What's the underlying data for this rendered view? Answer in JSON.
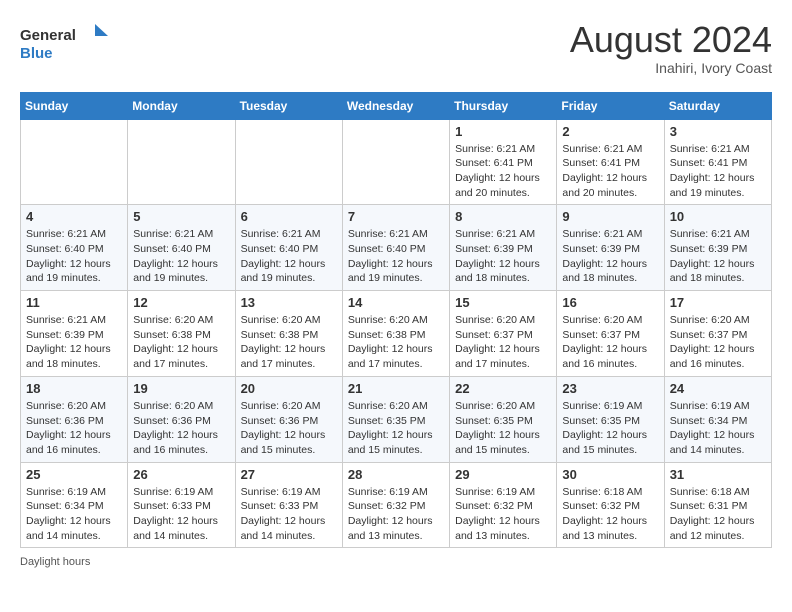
{
  "logo": {
    "text_general": "General",
    "text_blue": "Blue"
  },
  "title": "August 2024",
  "subtitle": "Inahiri, Ivory Coast",
  "days_of_week": [
    "Sunday",
    "Monday",
    "Tuesday",
    "Wednesday",
    "Thursday",
    "Friday",
    "Saturday"
  ],
  "weeks": [
    [
      {
        "day": "",
        "info": ""
      },
      {
        "day": "",
        "info": ""
      },
      {
        "day": "",
        "info": ""
      },
      {
        "day": "",
        "info": ""
      },
      {
        "day": "1",
        "info": "Sunrise: 6:21 AM\nSunset: 6:41 PM\nDaylight: 12 hours and 20 minutes."
      },
      {
        "day": "2",
        "info": "Sunrise: 6:21 AM\nSunset: 6:41 PM\nDaylight: 12 hours and 20 minutes."
      },
      {
        "day": "3",
        "info": "Sunrise: 6:21 AM\nSunset: 6:41 PM\nDaylight: 12 hours and 19 minutes."
      }
    ],
    [
      {
        "day": "4",
        "info": "Sunrise: 6:21 AM\nSunset: 6:40 PM\nDaylight: 12 hours and 19 minutes."
      },
      {
        "day": "5",
        "info": "Sunrise: 6:21 AM\nSunset: 6:40 PM\nDaylight: 12 hours and 19 minutes."
      },
      {
        "day": "6",
        "info": "Sunrise: 6:21 AM\nSunset: 6:40 PM\nDaylight: 12 hours and 19 minutes."
      },
      {
        "day": "7",
        "info": "Sunrise: 6:21 AM\nSunset: 6:40 PM\nDaylight: 12 hours and 19 minutes."
      },
      {
        "day": "8",
        "info": "Sunrise: 6:21 AM\nSunset: 6:39 PM\nDaylight: 12 hours and 18 minutes."
      },
      {
        "day": "9",
        "info": "Sunrise: 6:21 AM\nSunset: 6:39 PM\nDaylight: 12 hours and 18 minutes."
      },
      {
        "day": "10",
        "info": "Sunrise: 6:21 AM\nSunset: 6:39 PM\nDaylight: 12 hours and 18 minutes."
      }
    ],
    [
      {
        "day": "11",
        "info": "Sunrise: 6:21 AM\nSunset: 6:39 PM\nDaylight: 12 hours and 18 minutes."
      },
      {
        "day": "12",
        "info": "Sunrise: 6:20 AM\nSunset: 6:38 PM\nDaylight: 12 hours and 17 minutes."
      },
      {
        "day": "13",
        "info": "Sunrise: 6:20 AM\nSunset: 6:38 PM\nDaylight: 12 hours and 17 minutes."
      },
      {
        "day": "14",
        "info": "Sunrise: 6:20 AM\nSunset: 6:38 PM\nDaylight: 12 hours and 17 minutes."
      },
      {
        "day": "15",
        "info": "Sunrise: 6:20 AM\nSunset: 6:37 PM\nDaylight: 12 hours and 17 minutes."
      },
      {
        "day": "16",
        "info": "Sunrise: 6:20 AM\nSunset: 6:37 PM\nDaylight: 12 hours and 16 minutes."
      },
      {
        "day": "17",
        "info": "Sunrise: 6:20 AM\nSunset: 6:37 PM\nDaylight: 12 hours and 16 minutes."
      }
    ],
    [
      {
        "day": "18",
        "info": "Sunrise: 6:20 AM\nSunset: 6:36 PM\nDaylight: 12 hours and 16 minutes."
      },
      {
        "day": "19",
        "info": "Sunrise: 6:20 AM\nSunset: 6:36 PM\nDaylight: 12 hours and 16 minutes."
      },
      {
        "day": "20",
        "info": "Sunrise: 6:20 AM\nSunset: 6:36 PM\nDaylight: 12 hours and 15 minutes."
      },
      {
        "day": "21",
        "info": "Sunrise: 6:20 AM\nSunset: 6:35 PM\nDaylight: 12 hours and 15 minutes."
      },
      {
        "day": "22",
        "info": "Sunrise: 6:20 AM\nSunset: 6:35 PM\nDaylight: 12 hours and 15 minutes."
      },
      {
        "day": "23",
        "info": "Sunrise: 6:19 AM\nSunset: 6:35 PM\nDaylight: 12 hours and 15 minutes."
      },
      {
        "day": "24",
        "info": "Sunrise: 6:19 AM\nSunset: 6:34 PM\nDaylight: 12 hours and 14 minutes."
      }
    ],
    [
      {
        "day": "25",
        "info": "Sunrise: 6:19 AM\nSunset: 6:34 PM\nDaylight: 12 hours and 14 minutes."
      },
      {
        "day": "26",
        "info": "Sunrise: 6:19 AM\nSunset: 6:33 PM\nDaylight: 12 hours and 14 minutes."
      },
      {
        "day": "27",
        "info": "Sunrise: 6:19 AM\nSunset: 6:33 PM\nDaylight: 12 hours and 14 minutes."
      },
      {
        "day": "28",
        "info": "Sunrise: 6:19 AM\nSunset: 6:32 PM\nDaylight: 12 hours and 13 minutes."
      },
      {
        "day": "29",
        "info": "Sunrise: 6:19 AM\nSunset: 6:32 PM\nDaylight: 12 hours and 13 minutes."
      },
      {
        "day": "30",
        "info": "Sunrise: 6:18 AM\nSunset: 6:32 PM\nDaylight: 12 hours and 13 minutes."
      },
      {
        "day": "31",
        "info": "Sunrise: 6:18 AM\nSunset: 6:31 PM\nDaylight: 12 hours and 12 minutes."
      }
    ]
  ],
  "footer": {
    "daylight_hours_label": "Daylight hours"
  }
}
